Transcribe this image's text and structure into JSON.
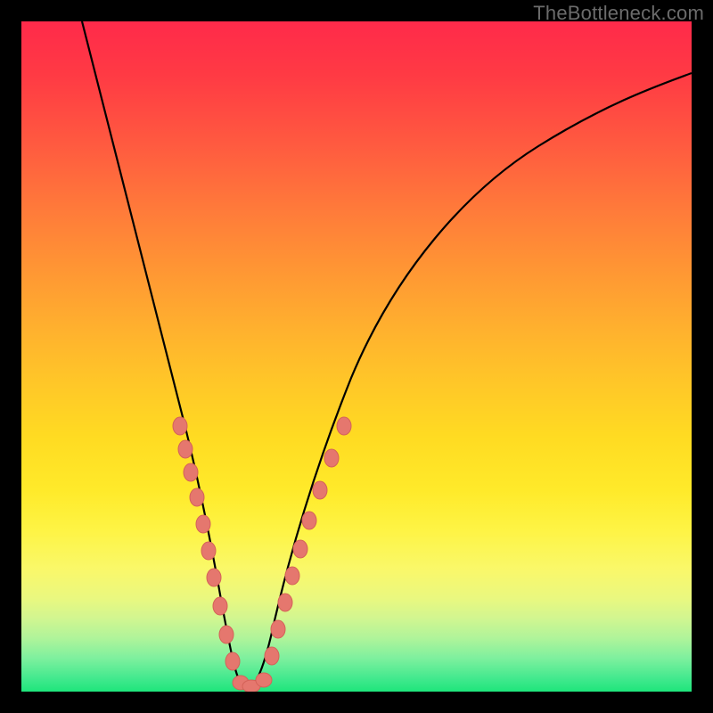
{
  "watermark": "TheBottleneck.com",
  "chart_data": {
    "type": "line",
    "title": "",
    "xlabel": "",
    "ylabel": "",
    "xlim": [
      0,
      100
    ],
    "ylim": [
      0,
      100
    ],
    "grid": false,
    "series": [
      {
        "name": "curve",
        "x": [
          9,
          12,
          15,
          18,
          20,
          22,
          23.5,
          25,
          26.5,
          28,
          29,
          29.8,
          30.6,
          31.4,
          32.3,
          33.5,
          35,
          37,
          40,
          44,
          48,
          53,
          58,
          64,
          70,
          77,
          85,
          93,
          100
        ],
        "y": [
          100,
          85,
          72,
          60,
          52,
          44,
          38,
          32,
          26,
          20,
          14,
          9,
          5,
          2,
          0.5,
          0.5,
          2,
          6,
          13,
          22,
          30,
          38,
          45,
          52,
          58,
          64,
          70,
          75,
          78
        ],
        "color": "#000000"
      }
    ],
    "markers": {
      "name": "highlight-beads",
      "x_ranges": [
        [
          22,
          28
        ],
        [
          33,
          38
        ]
      ],
      "color": "#e5776e",
      "size": 12
    }
  },
  "colors": {
    "frame": "#000000",
    "gradient_top": "#ff2a4a",
    "gradient_bottom": "#1ee57b",
    "curve": "#000000",
    "bead_fill": "#e5776e",
    "bead_stroke": "#d46258",
    "watermark": "#6b6b6b"
  }
}
